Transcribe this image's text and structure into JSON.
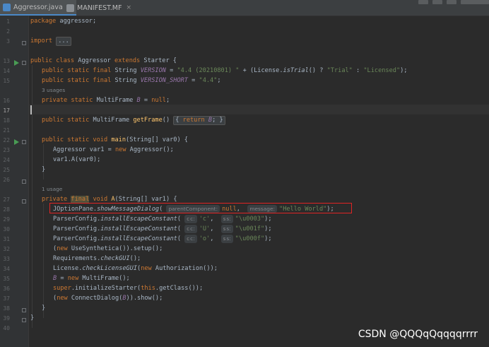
{
  "tabs": [
    {
      "label": "Aggressor.java",
      "active": true,
      "icon": "java-class-icon",
      "close": "×"
    },
    {
      "label": "MANIFEST.MF",
      "active": false,
      "icon": "manifest-file-icon",
      "close": "×"
    }
  ],
  "line_numbers": [
    "1",
    "2",
    "3",
    "13",
    "14",
    "15",
    "",
    "16",
    "17",
    "18",
    "21",
    "22",
    "23",
    "24",
    "25",
    "26",
    "",
    "27",
    "28",
    "29",
    "30",
    "31",
    "32",
    "33",
    "34",
    "35",
    "36",
    "37",
    "38",
    "39",
    "40"
  ],
  "code": {
    "l1_kw": "package",
    "l1_rest": " aggressor;",
    "l3_kw": "import",
    "l3_fold": "...",
    "l13_a": "public class",
    "l13_b": " Aggressor ",
    "l13_c": "extends",
    "l13_d": " Starter {",
    "l14_kw": "public static final",
    "l14_type": " String ",
    "l14_const": "VERSION",
    "l14_eq": " = ",
    "l14_str": "\"4.4 (20210801) \"",
    "l14_mid": " + (License.",
    "l14_st": "isTrial",
    "l14_mid2": "() ? ",
    "l14_str2": "\"Trial\"",
    "l14_mid3": " : ",
    "l14_str3": "\"Licensed\"",
    "l14_end": ");",
    "l15_kw": "public static final",
    "l15_type": " String ",
    "l15_const": "VERSION_SHORT",
    "l15_eq": " = ",
    "l15_str": "\"4.4\"",
    "l15_end": ";",
    "usage1": "3 usages",
    "l16_kw": "private static",
    "l16_type": " MultiFrame ",
    "l16_const": "B",
    "l16_eq": " = ",
    "l16_null": "null",
    "l16_end": ";",
    "l18_kw": "public static",
    "l18_type": " MultiFrame ",
    "l18_fn": "getFrame",
    "l18_paren": "() ",
    "l18_fold_kw": "return",
    "l18_fold_const": "B",
    "l18_fold_end": ";",
    "l22_kw": "public static void",
    "l22_fn": " main",
    "l22_rest": "(String[] var0) {",
    "l23_a": "Aggressor var1 = ",
    "l23_kw": "new",
    "l23_b": " Aggressor();",
    "l24": "var1.A(var0);",
    "l25": "}",
    "usage2": "1 usage",
    "l27_kw": "private",
    "l27_final": "final",
    "l27_void": "void",
    "l27_fn": "A",
    "l27_rest": "(String[] var1) {",
    "l28_a": "JOptionPane.",
    "l28_st": "showMessageDialog",
    "l28_b": "(",
    "l28_hint1": "parentComponent:",
    "l28_null": "null",
    "l28_comma": ",",
    "l28_hint2": "message:",
    "l28_str": "\"Hello World\"",
    "l28_end": ");",
    "pc_obj": "ParserConfig.",
    "pc_fn": "installEscapeConstant",
    "hint_c": "c:",
    "hint_s": "s:",
    "l29_c": "'c'",
    "l29_s": "\"\\u0003\"",
    "l30_c": "'U'",
    "l30_s": "\"\\u001f\"",
    "l31_c": "'o'",
    "l31_s": "\"\\u000f\"",
    "l32_a": "(",
    "l32_kw": "new",
    "l32_b": " UseSynthetica()).setup();",
    "l33_a": "Requirements.",
    "l33_st": "checkGUI",
    "l33_b": "();",
    "l34_a": "License.",
    "l34_st": "checkLicenseGUI",
    "l34_b": "(",
    "l34_kw": "new",
    "l34_c": " Authorization());",
    "l35_const": "B",
    "l35_eq": " = ",
    "l35_kw": "new",
    "l35_b": " MultiFrame();",
    "l36_kw": "super",
    "l36_a": ".initializeStarter(",
    "l36_kw2": "this",
    "l36_b": ".getClass());",
    "l37_a": "(",
    "l37_kw": "new",
    "l37_b": " ConnectDialog(",
    "l37_const": "B",
    "l37_c": ")).show();",
    "l38": "}",
    "l39": "}"
  },
  "watermark": "CSDN @QQQqQqqqqrrrr",
  "colors": {
    "background": "#2b2b2b",
    "keyword": "#cc7832",
    "string": "#6a8759",
    "constant": "#9876aa",
    "function": "#ffc66d",
    "highlight_box": "#e02424"
  }
}
